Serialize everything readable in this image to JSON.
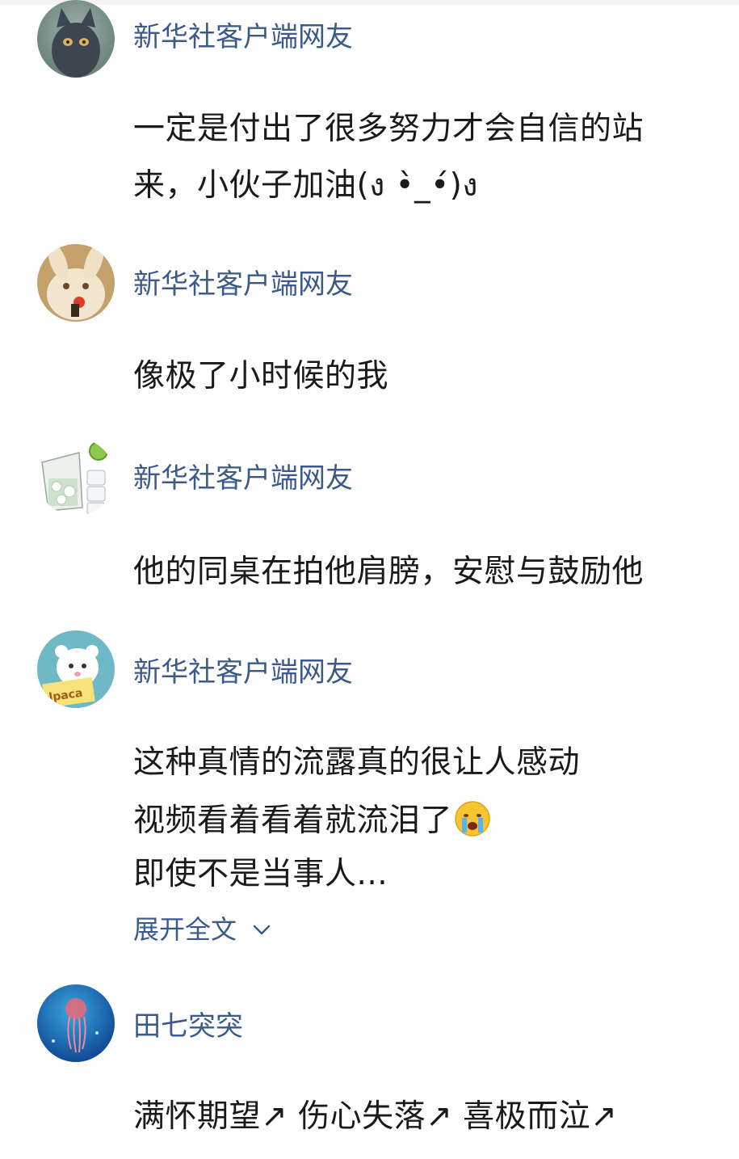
{
  "comments": [
    {
      "user": "新华社客户端网友",
      "avatar_icon": "cat-avatar-icon",
      "lines": [
        "一定是付出了很多努力才会自信的站",
        "来，小伙子加油(ง •̀_•́)ง"
      ]
    },
    {
      "user": "新华社客户端网友",
      "avatar_icon": "rabbit-avatar-icon",
      "lines": [
        "像极了小时候的我"
      ]
    },
    {
      "user": "新华社客户端网友",
      "avatar_icon": "cocktail-glass-avatar-icon",
      "lines": [
        "他的同桌在拍他肩膀，安慰与鼓励他"
      ]
    },
    {
      "user": "新华社客户端网友",
      "avatar_icon": "alpaca-avatar-icon",
      "avatar_text": "lpaca",
      "lines": [
        "这种真情的流露真的很让人感动",
        "视频看着看着就流泪了",
        "即使不是当事人..."
      ],
      "emoji": "crying-face-emoji",
      "expand_label": "展开全文"
    },
    {
      "user": "田七突突",
      "avatar_icon": "jellyfish-avatar-icon",
      "lines": [
        "满怀期望↗ 伤心失落↗ 喜极而泣↗"
      ]
    }
  ],
  "colors": {
    "username": "#3a5a8c",
    "text": "#1a1a1a",
    "link": "#3a5a8c"
  }
}
